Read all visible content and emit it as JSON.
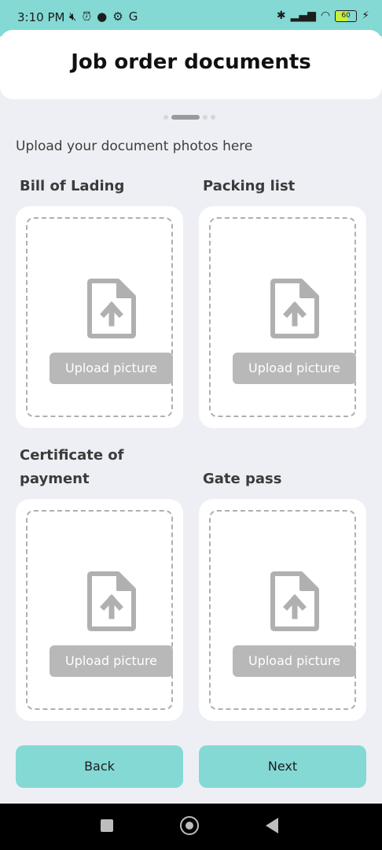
{
  "status_bar": {
    "time": "3:10 PM",
    "left_icons": [
      "mute-icon",
      "alarm-icon",
      "messenger-icon",
      "settings-icon",
      "google-icon"
    ],
    "right_icons": [
      "bluetooth-icon",
      "signal-icon",
      "wifi-icon",
      "battery-icon",
      "charging-icon"
    ],
    "battery_level": "60"
  },
  "header": {
    "title": "Job order documents"
  },
  "stepper": {
    "total_steps": 4,
    "current_step": 2
  },
  "instruction": "Upload your document photos here",
  "documents": [
    {
      "label": "Bill of Lading",
      "button_label": "Upload picture"
    },
    {
      "label": "Packing list",
      "button_label": "Upload picture"
    },
    {
      "label": "Certificate of payment",
      "button_label": "Upload picture"
    },
    {
      "label": "Gate pass",
      "button_label": "Upload picture"
    }
  ],
  "actions": {
    "back_label": "Back",
    "next_label": "Next"
  },
  "colors": {
    "accent": "#84d9d4",
    "background": "#eeeff4",
    "upload_button": "#b8b8b8",
    "icon": "#b0b0b0"
  }
}
